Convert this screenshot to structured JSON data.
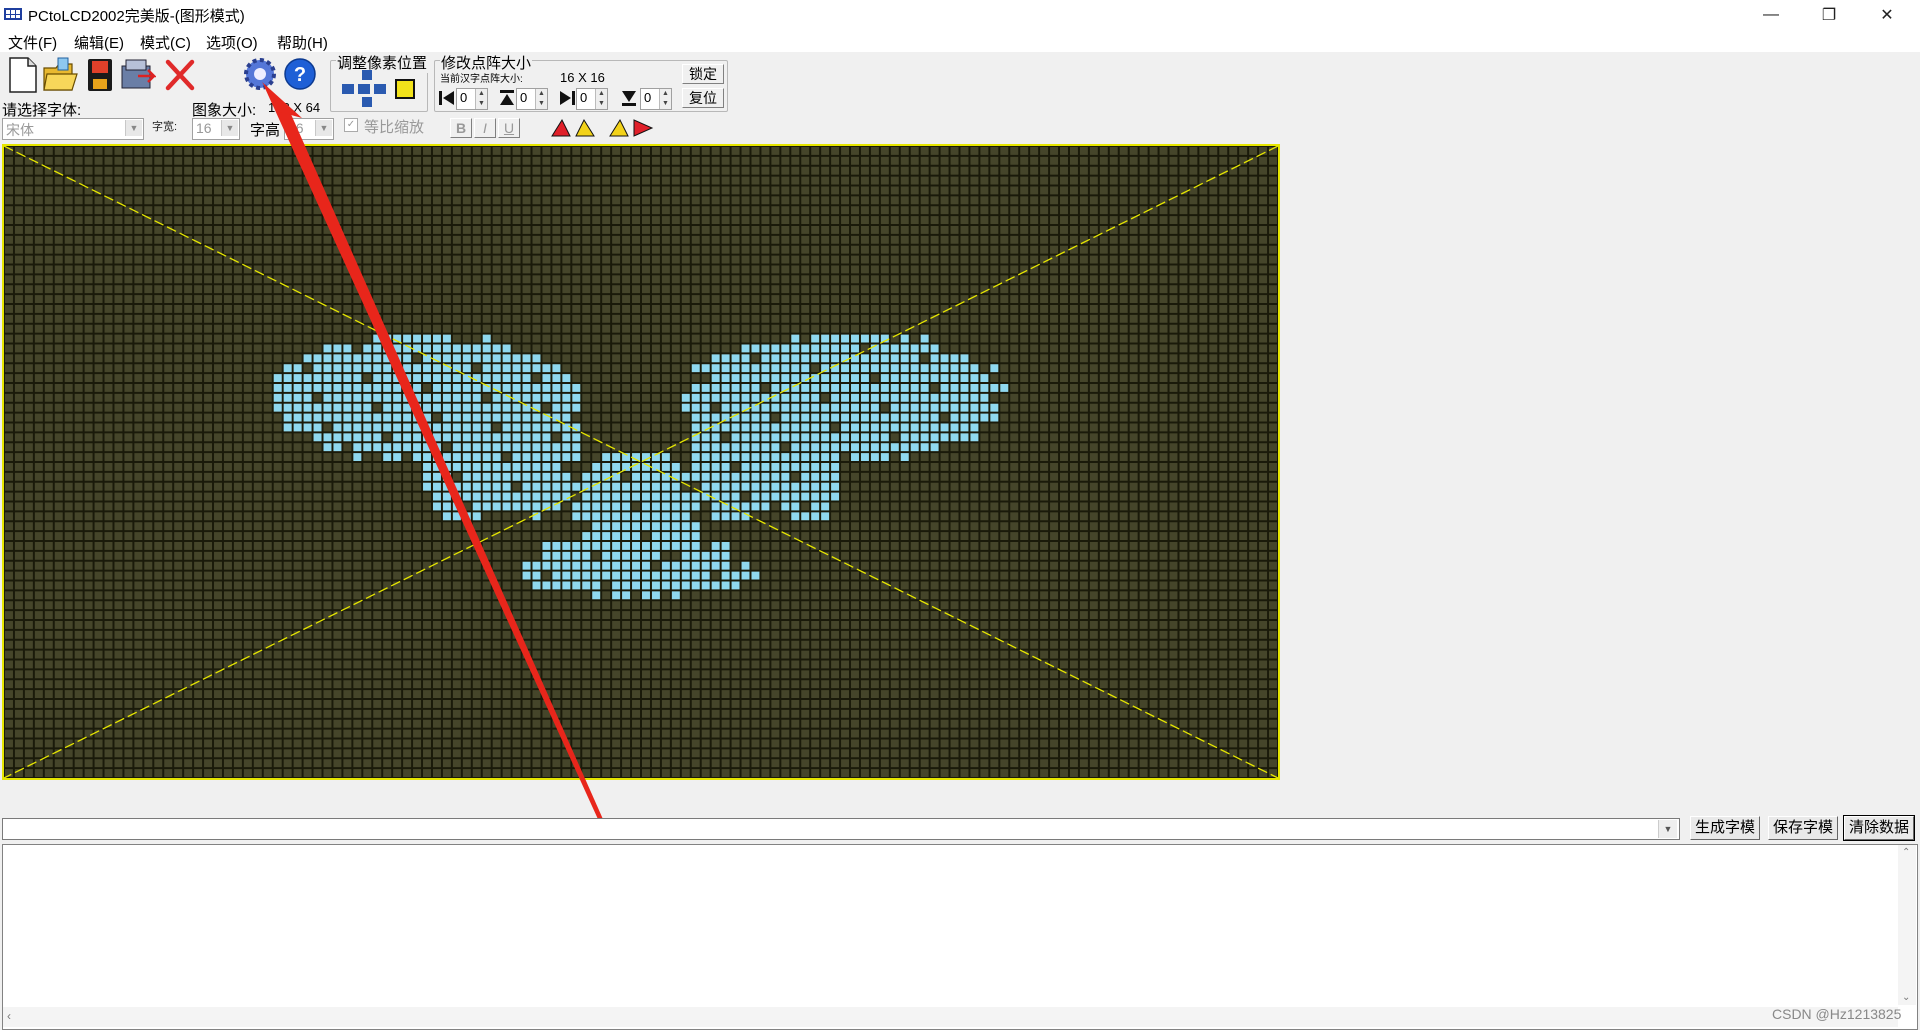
{
  "window": {
    "title": "PCtoLCD2002完美版-(图形模式)",
    "controls": {
      "minimize": "—",
      "maximize": "❐",
      "close": "✕"
    }
  },
  "menu": [
    "文件(F)",
    "编辑(E)",
    "模式(C)",
    "选项(O)",
    "帮助(H)"
  ],
  "toolbar": {
    "font_label": "请选择字体:",
    "font_value": "宋体",
    "char_width_label": "字宽:",
    "char_width_value": "16",
    "char_height_label": "字高",
    "char_height_value": "16",
    "image_size_label": "图象大小:",
    "image_size_value": "128 X 64",
    "proportional_label": "等比缩放",
    "bold": "B",
    "italic": "I",
    "underline": "U",
    "adjust_pixel_label": "调整像素位置",
    "modify_matrix_label": "修改点阵大小",
    "current_matrix_label": "当前汉字点阵大小:",
    "current_matrix_value": "16 X 16",
    "lock_label": "锁定",
    "reset_label": "复位",
    "spin_values": [
      "0",
      "0",
      "0",
      "0"
    ]
  },
  "canvas": {
    "grid_color": "#1a1a0a",
    "cell_color": "#45452a",
    "lit_color": "#8fd8ef",
    "border_color": "#e6e600",
    "diagonal_color": "#e6e600",
    "columns": 128,
    "rows": 64
  },
  "bottom": {
    "generate_label": "生成字模",
    "save_label": "保存字模",
    "clear_label": "清除数据",
    "output_text": ""
  },
  "overlay": {
    "arrow_color": "#e8261b"
  },
  "watermark": "CSDN @Hz1213825"
}
